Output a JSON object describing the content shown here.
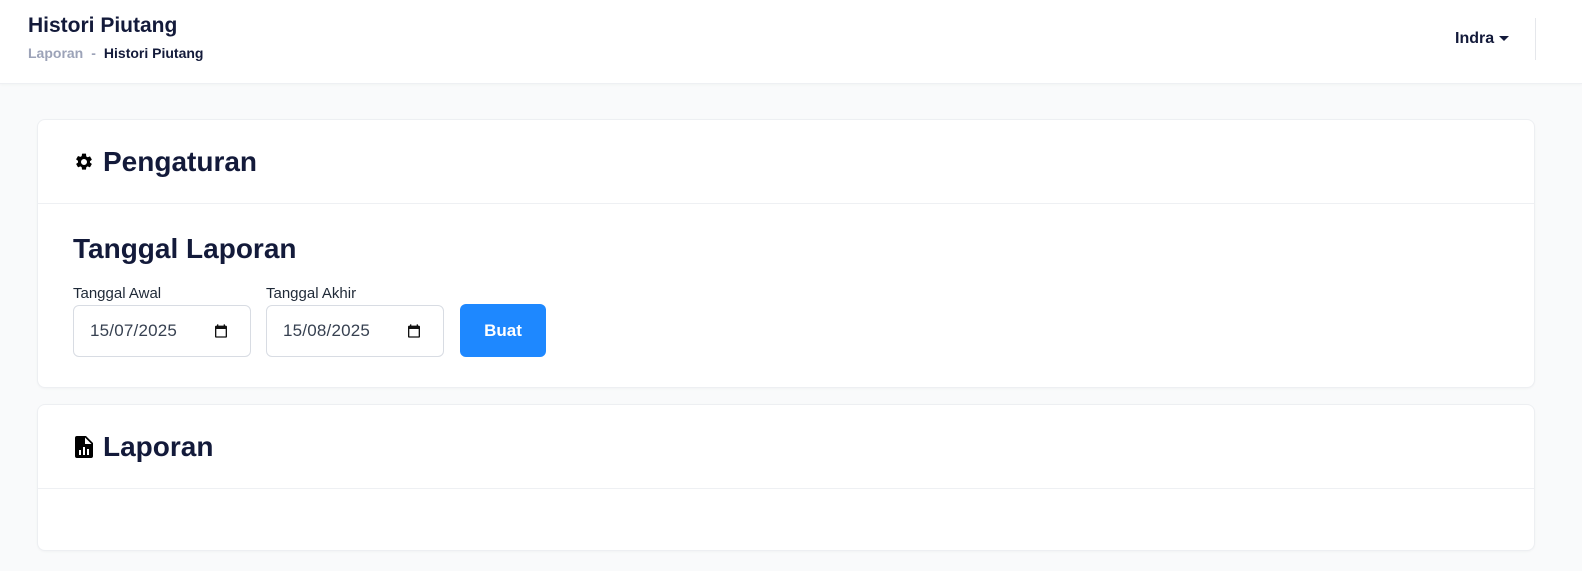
{
  "header": {
    "title": "Histori Piutang",
    "breadcrumb": {
      "parent": "Laporan",
      "separator": "-",
      "current": "Histori Piutang"
    },
    "user": {
      "name": "Indra",
      "icon": "caret-down-icon"
    }
  },
  "settings_card": {
    "icon": "gear-icon",
    "title": "Pengaturan",
    "section_title": "Tanggal Laporan",
    "start_date": {
      "label": "Tanggal Awal",
      "value": "15/07/2025",
      "icon": "calendar-icon"
    },
    "end_date": {
      "label": "Tanggal Akhir",
      "value": "15/08/2025",
      "icon": "calendar-icon"
    },
    "submit_label": "Buat"
  },
  "report_card": {
    "icon": "file-chart-icon",
    "title": "Laporan"
  },
  "colors": {
    "primary_button": "#1e88ff",
    "heading_text": "#131a3a",
    "muted_text": "#9ca3b8",
    "background": "#f9fafb"
  }
}
